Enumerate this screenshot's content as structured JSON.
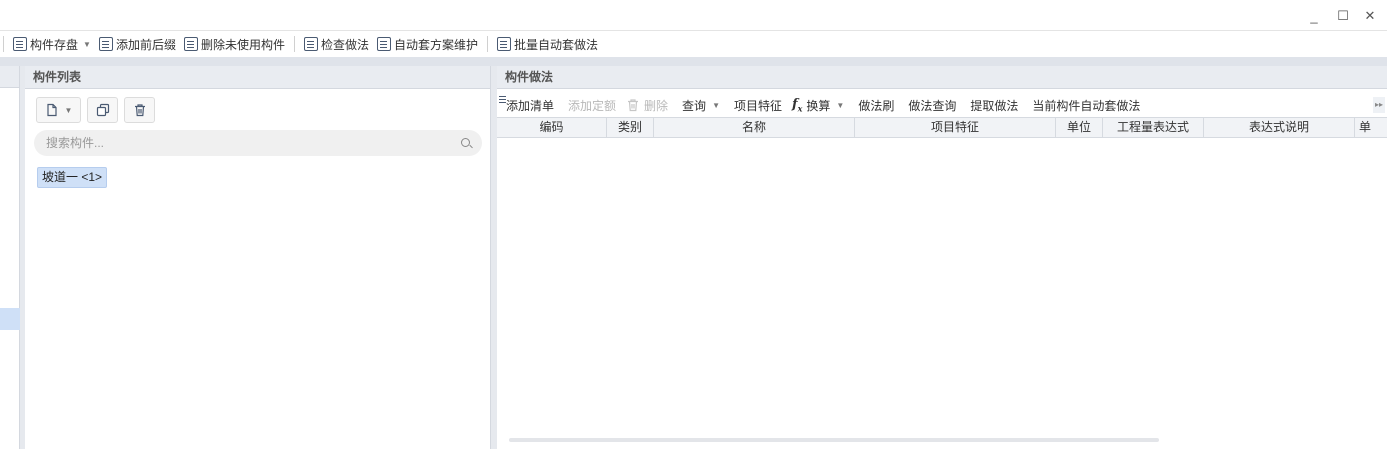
{
  "window": {
    "minimize": "_",
    "maximize": "☐",
    "close": "✕"
  },
  "toolbar": {
    "items": [
      {
        "label": "构件存盘",
        "icon": "save-component-icon",
        "has_dropdown": true
      },
      {
        "label": "添加前后缀",
        "icon": "prefix-suffix-icon"
      },
      {
        "label": "删除未使用构件",
        "icon": "delete-unused-icon"
      },
      {
        "label": "检查做法",
        "icon": "check-method-icon"
      },
      {
        "label": "自动套方案维护",
        "icon": "auto-scheme-icon"
      },
      {
        "label": "批量自动套做法",
        "icon": "batch-auto-method-icon"
      }
    ]
  },
  "component_list": {
    "title": "构件列表",
    "search_placeholder": "搜索构件...",
    "items": [
      {
        "label": "坡道一 <1>",
        "selected": true
      }
    ]
  },
  "method_panel": {
    "title": "构件做法",
    "toolbar": [
      {
        "label": "添加清单",
        "icon": "add-list-icon",
        "enabled": true
      },
      {
        "label": "添加定额",
        "icon": "add-quota-icon",
        "enabled": false
      },
      {
        "label": "删除",
        "icon": "trash-icon",
        "enabled": false
      },
      {
        "label": "查询",
        "icon": "query-icon",
        "enabled": true,
        "has_dropdown": true
      },
      {
        "label": "项目特征",
        "icon": "project-feature-icon",
        "enabled": true
      },
      {
        "label": "换算",
        "icon": "fx-icon",
        "enabled": true,
        "has_dropdown": true
      },
      {
        "label": "做法刷",
        "icon": "method-brush-icon",
        "enabled": true
      },
      {
        "label": "做法查询",
        "icon": "method-query-icon",
        "enabled": true
      },
      {
        "label": "提取做法",
        "icon": "extract-method-icon",
        "enabled": true
      },
      {
        "label": "当前构件自动套做法",
        "icon": "current-auto-method-icon",
        "enabled": true
      }
    ],
    "columns": [
      "编码",
      "类别",
      "名称",
      "项目特征",
      "单位",
      "工程量表达式",
      "表达式说明",
      "单"
    ],
    "rows": []
  }
}
